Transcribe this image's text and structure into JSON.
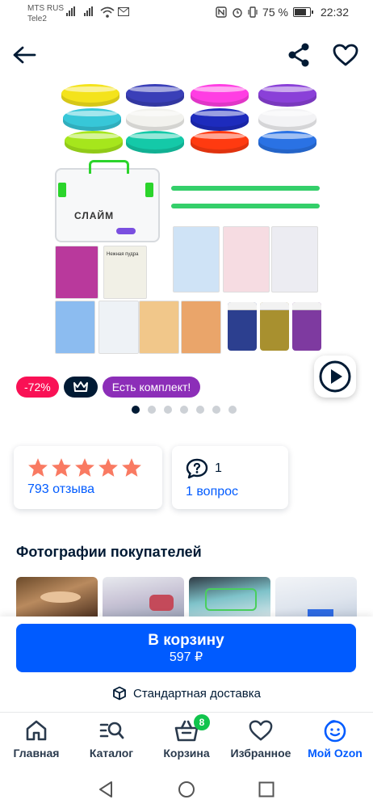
{
  "status_bar": {
    "carrier_1": "MTS RUS",
    "carrier_2": "Tele2",
    "battery": "75 %",
    "time": "22:32"
  },
  "top_bar": {
    "back_icon": "arrow-left-icon",
    "share_icon": "share-icon",
    "favorite_icon": "heart-outline-icon"
  },
  "gallery": {
    "images_total": 7,
    "active_index": 0,
    "product_label_main": "СЛАЙМ",
    "sachet_label": "Нежная пудра",
    "video_icon": "play-circle-icon"
  },
  "badges": {
    "discount": "-72%",
    "premium_icon": "crown-icon",
    "kit": "Есть комплект!"
  },
  "rating": {
    "stars": 5,
    "star_color": "#f97a62",
    "reviews": "793 отзыва"
  },
  "questions": {
    "count": "1",
    "link": "1 вопрос"
  },
  "customer_photos": {
    "title": "Фотографии покупателей"
  },
  "cart": {
    "button": "В корзину",
    "price": "597 ₽",
    "delivery": "Стандартная доставка",
    "accent": "#005bff"
  },
  "tabbar": {
    "items": [
      {
        "label": "Главная",
        "icon": "home-icon"
      },
      {
        "label": "Каталог",
        "icon": "catalog-search-icon"
      },
      {
        "label": "Корзина",
        "icon": "basket-icon",
        "count": "8"
      },
      {
        "label": "Избранное",
        "icon": "heart-icon"
      },
      {
        "label": "Мой Ozon",
        "icon": "smile-icon"
      }
    ]
  },
  "system_nav": {
    "back": "triangle-back-icon",
    "home": "circle-home-icon",
    "recents": "square-recents-icon"
  }
}
